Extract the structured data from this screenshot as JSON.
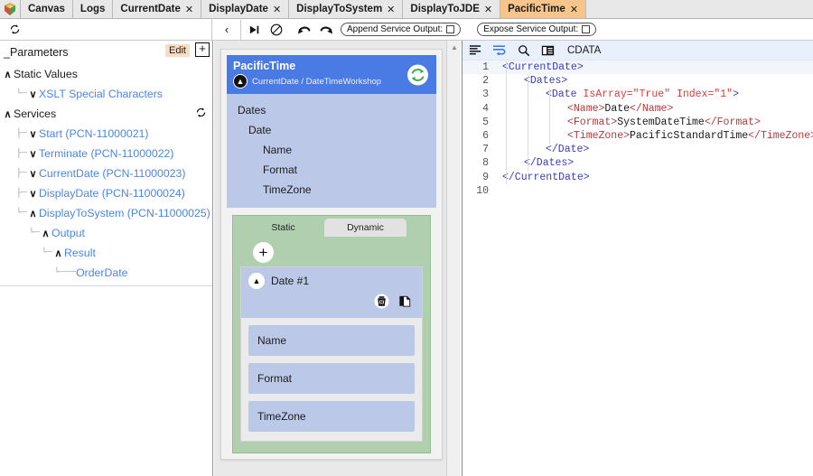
{
  "tabbar": {
    "logo_icon": "app-logo-icon",
    "tabs": [
      {
        "label": "Canvas",
        "closable": false,
        "active": false
      },
      {
        "label": "Logs",
        "closable": false,
        "active": false
      },
      {
        "label": "CurrentDate",
        "closable": true,
        "active": false
      },
      {
        "label": "DisplayDate",
        "closable": true,
        "active": false
      },
      {
        "label": "DisplayToSystem",
        "closable": true,
        "active": false
      },
      {
        "label": "DisplayToJDE",
        "closable": true,
        "active": false
      },
      {
        "label": "PacificTime",
        "closable": true,
        "active": true
      }
    ],
    "close_glyph": "✕"
  },
  "toolbar": {
    "refresh_left_icon": "refresh-icon",
    "back_icon": "‹",
    "step_icon": "▶|",
    "block_icon": "⊘",
    "undo_icon": "↶",
    "redo_icon": "↷",
    "append_service_output_label": "Append Service Output:",
    "expose_service_output_label": "Expose Service Output:",
    "append_checked": false,
    "expose_checked": false
  },
  "sidebar": {
    "header": {
      "title": "_Parameters",
      "edit_label": "Edit",
      "add_label": "+"
    },
    "refresh_icon": "refresh-icon",
    "tree": [
      {
        "label": "Static Values",
        "indent": 0,
        "chevron": "∧",
        "link": false,
        "guide": ""
      },
      {
        "label": "XSLT Special Characters",
        "indent": 1,
        "chevron": "∨",
        "link": true,
        "guide": "└┈"
      },
      {
        "label": "Services",
        "indent": 0,
        "chevron": "∧",
        "link": false,
        "guide": "",
        "has_refresh": true
      },
      {
        "label": "Start (PCN-11000021)",
        "indent": 1,
        "chevron": "∨",
        "link": true,
        "guide": "├┈"
      },
      {
        "label": "Terminate (PCN-11000022)",
        "indent": 1,
        "chevron": "∨",
        "link": true,
        "guide": "├┈"
      },
      {
        "label": "CurrentDate (PCN-11000023)",
        "indent": 1,
        "chevron": "∨",
        "link": true,
        "guide": "├┈"
      },
      {
        "label": "DisplayDate (PCN-11000024)",
        "indent": 1,
        "chevron": "∨",
        "link": true,
        "guide": "├┈"
      },
      {
        "label": "DisplayToSystem (PCN-11000025)",
        "indent": 1,
        "chevron": "∧",
        "link": true,
        "guide": "└┈"
      },
      {
        "label": "Output",
        "indent": 2,
        "chevron": "∧",
        "link": true,
        "guide": "└┈"
      },
      {
        "label": "Result",
        "indent": 3,
        "chevron": "∧",
        "link": true,
        "guide": "└┈"
      },
      {
        "label": "OrderDate",
        "indent": 4,
        "chevron": "",
        "link": true,
        "guide": "└┈┈┈"
      }
    ]
  },
  "middle": {
    "card": {
      "title": "PacificTime",
      "subtitle": "CurrentDate / DateTimeWorkshop",
      "collapse_icon": "chevron-up-icon",
      "sync_icon": "sync-icon",
      "fields": [
        {
          "label": "Dates",
          "level": 0
        },
        {
          "label": "Date",
          "level": 1
        },
        {
          "label": "Name",
          "level": 2
        },
        {
          "label": "Format",
          "level": 2
        },
        {
          "label": "TimeZone",
          "level": 2
        }
      ],
      "tabs": [
        {
          "label": "Static",
          "selected": true
        },
        {
          "label": "Dynamic",
          "selected": false
        }
      ],
      "add_button_label": "+",
      "entry": {
        "name": "Date #1",
        "collapse_icon": "chevron-up-icon",
        "delete_icon": "delete-icon",
        "copy_icon": "copy-icon",
        "rows": [
          {
            "label": "Name"
          },
          {
            "label": "Format"
          },
          {
            "label": "TimeZone"
          }
        ]
      }
    }
  },
  "editor": {
    "toolbar": {
      "format_icon": "align-left-icon",
      "wrap_icon": "word-wrap-icon",
      "search_icon": "search-icon",
      "panel_icon": "split-panel-icon",
      "mode_label": "CDATA"
    },
    "lines": [
      {
        "n": "1",
        "indent": 0,
        "highlight": true,
        "parts": [
          {
            "t": "tagb",
            "v": "<CurrentDate>"
          }
        ]
      },
      {
        "n": "2",
        "indent": 1,
        "highlight": false,
        "parts": [
          {
            "t": "tagb",
            "v": "<Dates>"
          }
        ]
      },
      {
        "n": "3",
        "indent": 2,
        "highlight": false,
        "parts": [
          {
            "t": "tagb",
            "v": "<Date "
          },
          {
            "t": "attr",
            "v": "IsArray=\"True\" Index=\"1\""
          },
          {
            "t": "tagb",
            "v": ">"
          }
        ]
      },
      {
        "n": "4",
        "indent": 3,
        "highlight": false,
        "parts": [
          {
            "t": "tagr",
            "v": "<Name>"
          },
          {
            "t": "ival",
            "v": "Date"
          },
          {
            "t": "tagr",
            "v": "</Name>"
          }
        ]
      },
      {
        "n": "5",
        "indent": 3,
        "highlight": false,
        "parts": [
          {
            "t": "tagr",
            "v": "<Format>"
          },
          {
            "t": "ival",
            "v": "SystemDateTime"
          },
          {
            "t": "tagr",
            "v": "</Format>"
          }
        ]
      },
      {
        "n": "6",
        "indent": 3,
        "highlight": false,
        "parts": [
          {
            "t": "tagr",
            "v": "<TimeZone>"
          },
          {
            "t": "ival",
            "v": "PacificStandardTime"
          },
          {
            "t": "tagr",
            "v": "</TimeZone>"
          }
        ]
      },
      {
        "n": "7",
        "indent": 2,
        "highlight": false,
        "parts": [
          {
            "t": "tagb",
            "v": "</Date>"
          }
        ]
      },
      {
        "n": "8",
        "indent": 1,
        "highlight": false,
        "parts": [
          {
            "t": "tagb",
            "v": "</Dates>"
          }
        ]
      },
      {
        "n": "9",
        "indent": 0,
        "highlight": false,
        "parts": [
          {
            "t": "tagb",
            "v": "</CurrentDate>"
          }
        ]
      },
      {
        "n": "10",
        "indent": 0,
        "highlight": false,
        "parts": []
      }
    ]
  },
  "colors": {
    "active_tab": "#f7c58b",
    "card_header": "#4a7ae4",
    "field_row": "#bcc8e8",
    "tab_block": "#b0cfae",
    "link": "#4a86e8",
    "editor_toolbar": "#e8f0fb"
  }
}
